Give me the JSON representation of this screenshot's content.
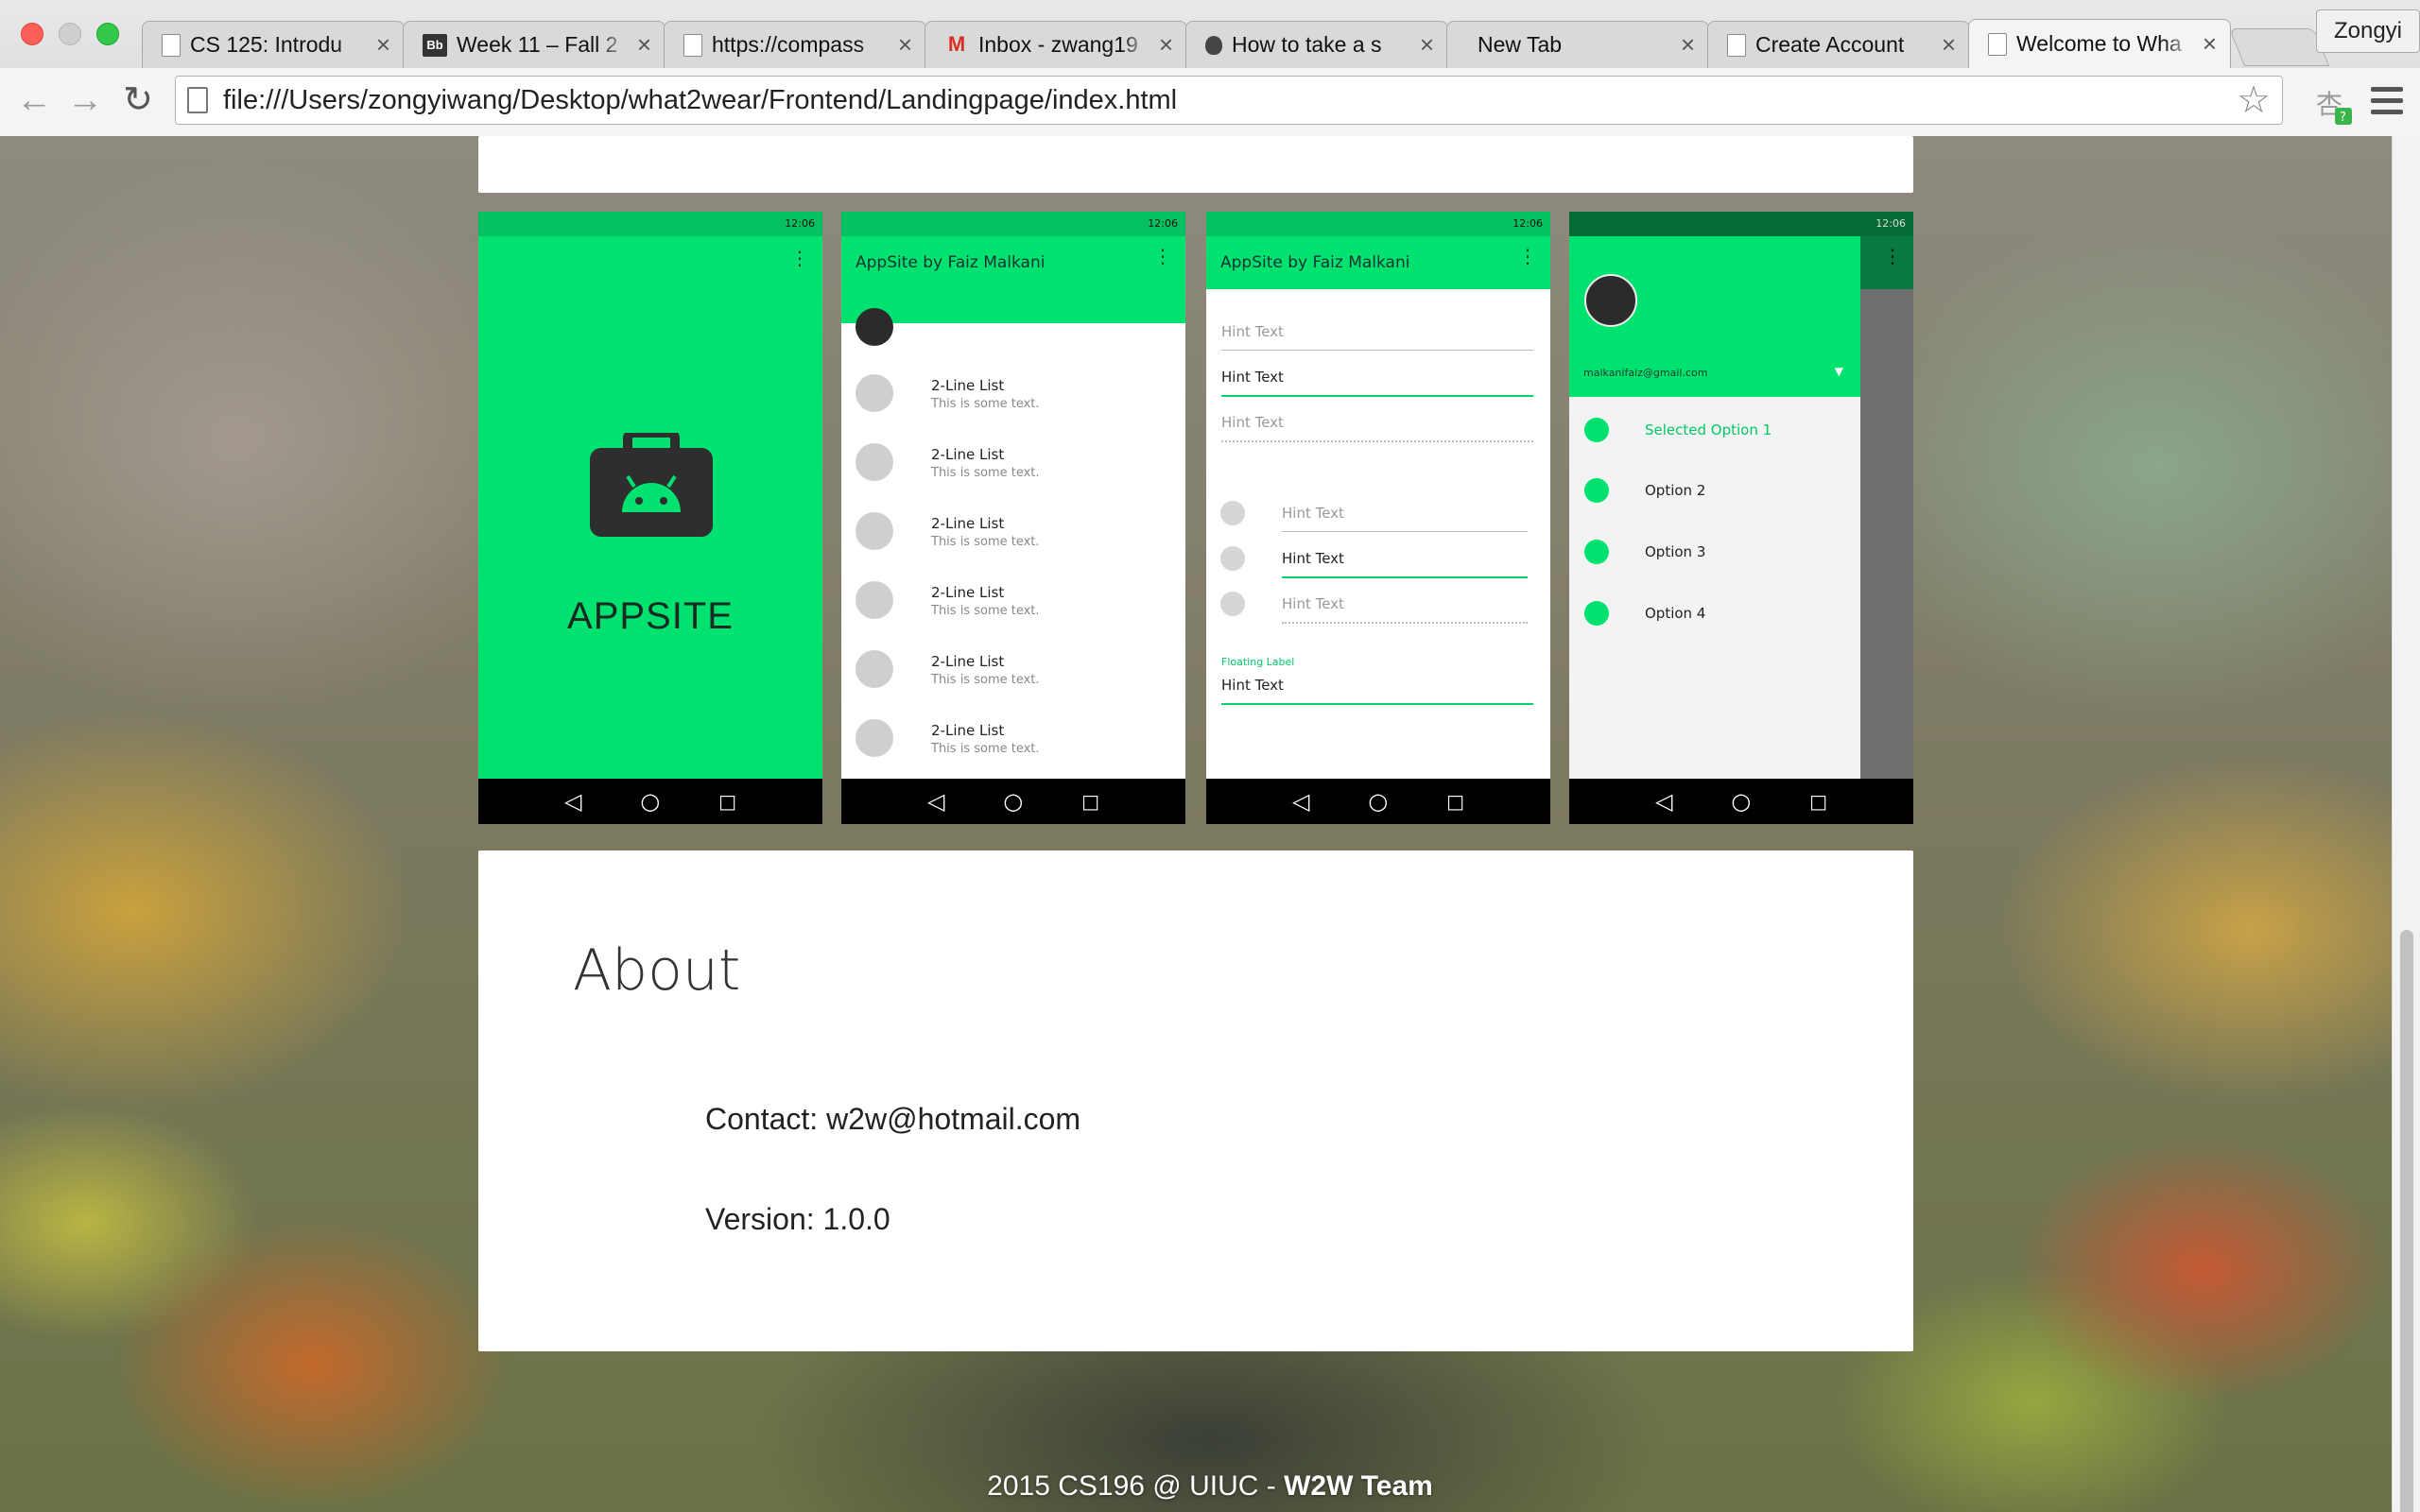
{
  "browser": {
    "profile": "Zongyi",
    "url": "file:///Users/zongyiwang/Desktop/what2wear/Frontend/Landingpage/index.html",
    "tabs": [
      {
        "title": "CS 125: Introdu",
        "icon": "page-icon"
      },
      {
        "title": "Week 11 – Fall 2",
        "icon": "blackboard-icon",
        "icon_text": "Bb"
      },
      {
        "title": "https://compass",
        "icon": "page-icon"
      },
      {
        "title": "Inbox - zwang19",
        "icon": "gmail-icon",
        "icon_text": "M"
      },
      {
        "title": "How to take a s",
        "icon": "apple-icon"
      },
      {
        "title": "New Tab",
        "icon": "none"
      },
      {
        "title": "Create Account",
        "icon": "page-icon"
      },
      {
        "title": "Welcome to Wha",
        "icon": "page-icon"
      }
    ],
    "active_tab": 7,
    "close_glyph": "×"
  },
  "colors": {
    "accent": "#00e270",
    "accent_dark": "#03c060",
    "drawer_scrim_bar": "#087a3f"
  },
  "screens": {
    "status_time": "12:06",
    "splash": {
      "brand": "APPSITE",
      "icon": "android-briefcase-icon"
    },
    "list": {
      "title": "AppSite by Faiz Malkani",
      "items": [
        {
          "primary": "2-Line List",
          "secondary": "This is some text."
        },
        {
          "primary": "2-Line List",
          "secondary": "This is some text."
        },
        {
          "primary": "2-Line List",
          "secondary": "This is some text."
        },
        {
          "primary": "2-Line List",
          "secondary": "This is some text."
        },
        {
          "primary": "2-Line List",
          "secondary": "This is some text."
        },
        {
          "primary": "2-Line List",
          "secondary": "This is some text."
        }
      ]
    },
    "form": {
      "title": "AppSite by Faiz Malkani",
      "hint": "Hint Text",
      "floating_label": "Floating Label"
    },
    "drawer": {
      "email": "malkanifaiz@gmail.com",
      "options": [
        "Selected Option 1",
        "Option 2",
        "Option 3",
        "Option 4"
      ]
    }
  },
  "about": {
    "heading": "About",
    "contact": "Contact: w2w@hotmail.com",
    "version": "Version: 1.0.0"
  },
  "footer": {
    "text": "2015 CS196 @ UIUC - ",
    "team": "W2W Team"
  }
}
